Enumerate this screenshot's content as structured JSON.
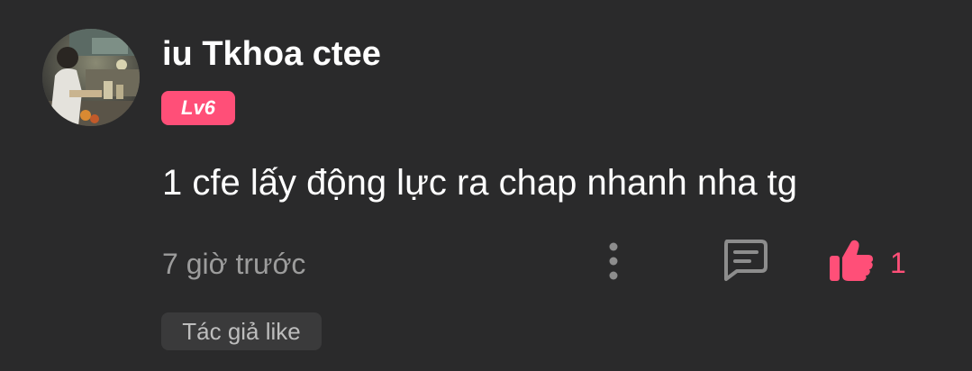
{
  "comment": {
    "username": "iu Tkhoa ctee",
    "level": "Lv6",
    "text": "1 cfe lấy động lực ra chap nhanh nha tg",
    "timestamp": "7 giờ trước",
    "like_count": "1",
    "author_like_tag": "Tác giả like"
  },
  "icons": {
    "avatar": "user-photo-avatar",
    "more": "more-vertical-icon",
    "reply": "comment-bubble-icon",
    "like": "thumbs-up-icon"
  },
  "colors": {
    "background": "#2a2a2b",
    "accent_pink": "#ff4f78",
    "secondary_text": "#9c9c9c",
    "icon_gray": "#8d8d8d",
    "tag_background": "#3a3a3b"
  }
}
